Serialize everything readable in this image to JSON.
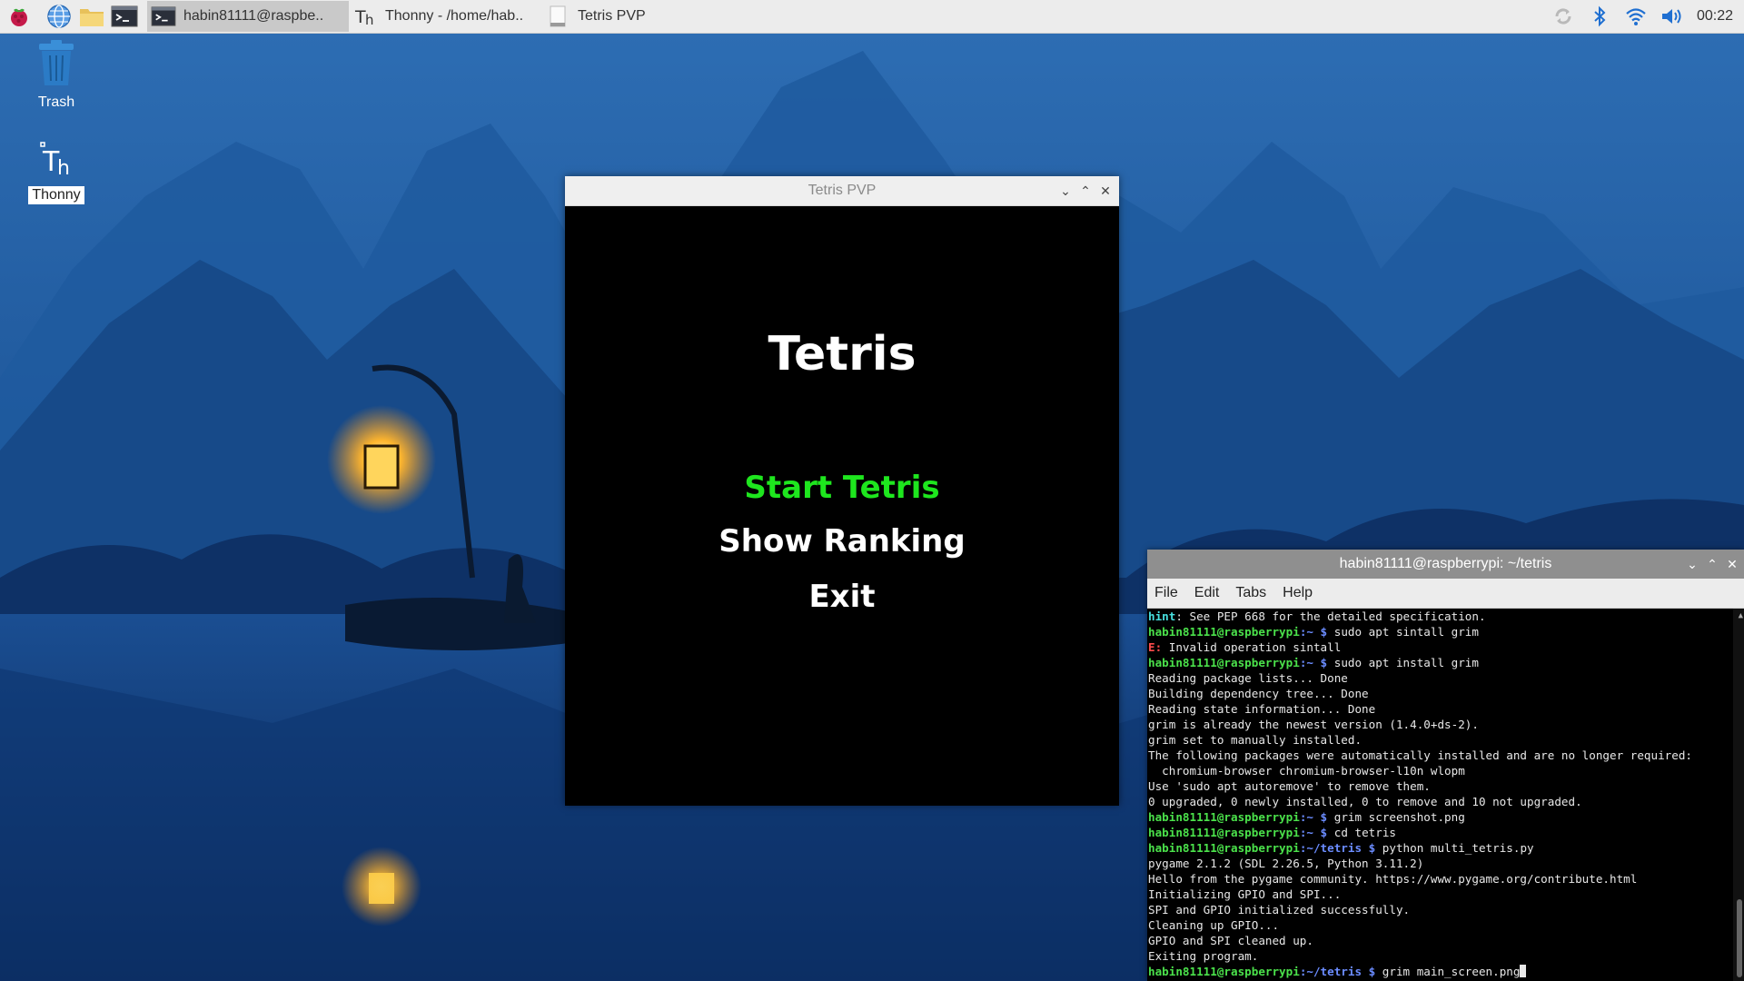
{
  "taskbar": {
    "tasks": [
      {
        "label": "habin81111@raspbe.."
      },
      {
        "label": "Thonny  -  /home/hab.."
      },
      {
        "label": "Tetris PVP"
      }
    ],
    "clock": "00:22"
  },
  "desktop": {
    "icons": [
      {
        "label": "Trash"
      },
      {
        "label": "Thonny"
      }
    ]
  },
  "tetris_window": {
    "title": "Tetris PVP",
    "game_title": "Tetris",
    "menu": [
      {
        "label": "Start Tetris",
        "selected": true
      },
      {
        "label": "Show Ranking"
      },
      {
        "label": "Exit"
      }
    ],
    "highlight_color": "#1ee61e"
  },
  "terminal": {
    "title": "habin81111@raspberrypi: ~/tetris",
    "menu": [
      "File",
      "Edit",
      "Tabs",
      "Help"
    ],
    "prompt_user": "habin81111@raspberrypi",
    "lines": [
      {
        "tag": "hint",
        "text": ": See PEP 668 for the detailed specification."
      },
      {
        "path": ":~ $",
        "cmd": " sudo apt sintall grim"
      },
      {
        "tag": "E:",
        "text": " Invalid operation sintall"
      },
      {
        "path": ":~ $",
        "cmd": " sudo apt install grim"
      },
      {
        "text": "Reading package lists... Done"
      },
      {
        "text": "Building dependency tree... Done"
      },
      {
        "text": "Reading state information... Done"
      },
      {
        "text": "grim is already the newest version (1.4.0+ds-2)."
      },
      {
        "text": "grim set to manually installed."
      },
      {
        "text": "The following packages were automatically installed and are no longer required:"
      },
      {
        "text": "  chromium-browser chromium-browser-l10n wlopm"
      },
      {
        "text": "Use 'sudo apt autoremove' to remove them."
      },
      {
        "text": "0 upgraded, 0 newly installed, 0 to remove and 10 not upgraded."
      },
      {
        "path": ":~ $",
        "cmd": " grim screenshot.png"
      },
      {
        "path": ":~ $",
        "cmd": " cd tetris"
      },
      {
        "path": ":~/tetris $",
        "cmd": " python multi_tetris.py"
      },
      {
        "text": "pygame 2.1.2 (SDL 2.26.5, Python 3.11.2)"
      },
      {
        "text": "Hello from the pygame community. https://www.pygame.org/contribute.html"
      },
      {
        "text": "Initializing GPIO and SPI..."
      },
      {
        "text": "SPI and GPIO initialized successfully."
      },
      {
        "text": "Cleaning up GPIO..."
      },
      {
        "text": "GPIO and SPI cleaned up."
      },
      {
        "text": "Exiting program."
      },
      {
        "path": ":~/tetris $",
        "cmd": " grim main_screen.png",
        "cursor": true
      }
    ]
  }
}
